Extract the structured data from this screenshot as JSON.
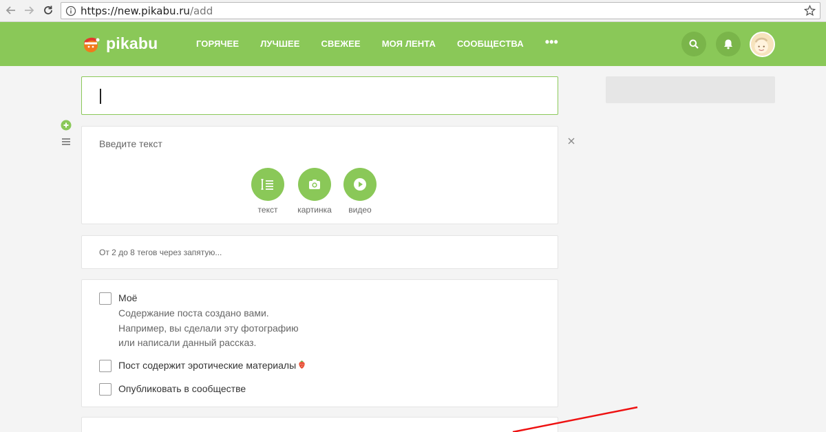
{
  "browser": {
    "url_host": "https://new.pikabu.ru",
    "url_path": "/add"
  },
  "header": {
    "logo_text": "pikabu",
    "menu": [
      "ГОРЯЧЕЕ",
      "ЛУЧШЕЕ",
      "СВЕЖЕЕ",
      "МОЯ ЛЕНТА",
      "СООБЩЕСТВА"
    ],
    "more": "•••",
    "accent": "#8ac858"
  },
  "editor": {
    "placeholder": "Введите текст",
    "tools": [
      {
        "label": "текст",
        "icon": "text-icon"
      },
      {
        "label": "картинка",
        "icon": "camera-icon"
      },
      {
        "label": "видео",
        "icon": "play-icon"
      }
    ]
  },
  "tags": {
    "placeholder": "От 2 до 8 тегов через запятую..."
  },
  "options": {
    "mine_label": "Моё",
    "mine_desc": [
      "Содержание поста создано вами.",
      "Например, вы сделали эту фотографию",
      "или написали данный рассказ."
    ],
    "erotic_label": "Пост содержит эротические материалы",
    "community_label": "Опубликовать в сообществе"
  }
}
